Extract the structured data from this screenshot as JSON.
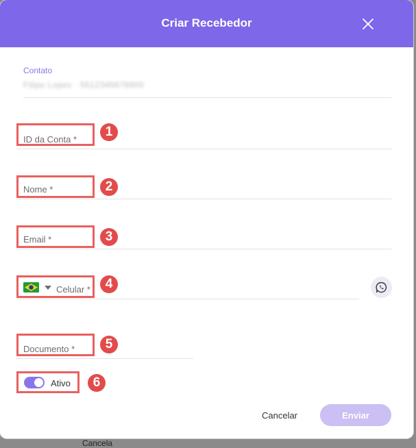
{
  "backdrop": {
    "peek_text": "Cancela"
  },
  "modal": {
    "title": "Criar Recebedor",
    "close_icon": "close-icon"
  },
  "contact": {
    "label": "Contato",
    "value": "Filipe Lopes · 5512345678900"
  },
  "fields": [
    {
      "label": "ID da Conta *",
      "badge": "1"
    },
    {
      "label": "Nome *",
      "badge": "2"
    },
    {
      "label": "Email *",
      "badge": "3"
    },
    {
      "label": "Celular *",
      "badge": "4",
      "country_icon": "brazil-flag-icon",
      "dropdown_icon": "caret-down-icon",
      "side_icon": "whatsapp-icon"
    },
    {
      "label": "Documento *",
      "badge": "5"
    }
  ],
  "toggle": {
    "label": "Ativo",
    "badge": "6",
    "on": true
  },
  "actions": {
    "cancel": "Cancelar",
    "submit": "Enviar"
  },
  "colors": {
    "header": "#7e67e8",
    "accent": "#8b74ea",
    "highlight": "#e8605f",
    "badge": "#e34b4b",
    "submit_disabled": "#cbbff3"
  }
}
